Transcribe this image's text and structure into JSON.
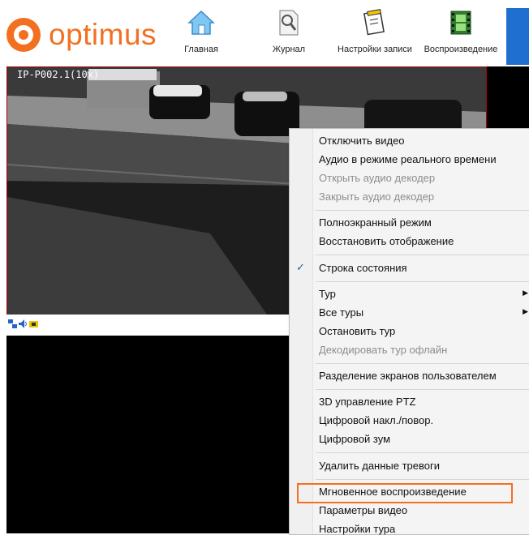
{
  "brand": {
    "logo_text": "optimus",
    "accent": "#f37021"
  },
  "nav": [
    {
      "label": "Главная",
      "icon": "home-icon"
    },
    {
      "label": "Журнал",
      "icon": "journal-icon"
    },
    {
      "label": "Настройки записи",
      "icon": "record-settings-icon"
    },
    {
      "label": "Воспроизведение",
      "icon": "playback-icon"
    }
  ],
  "video": {
    "camera_label": "IP-P002.1(10x)"
  },
  "context_menu": {
    "items": [
      {
        "label": "Отключить видео",
        "enabled": true
      },
      {
        "label": "Аудио в режиме реального времени",
        "enabled": true
      },
      {
        "label": "Открыть аудио декодер",
        "enabled": false
      },
      {
        "label": "Закрыть аудио декодер",
        "enabled": false
      },
      {
        "label": "Полноэкранный режим",
        "enabled": true
      },
      {
        "label": "Восстановить отображение",
        "enabled": true
      },
      {
        "label": "Строка состояния",
        "enabled": true,
        "checked": true
      },
      {
        "label": "Тур",
        "enabled": true,
        "submenu": true
      },
      {
        "label": "Все туры",
        "enabled": true,
        "submenu": true
      },
      {
        "label": "Остановить тур",
        "enabled": true
      },
      {
        "label": "Декодировать тур офлайн",
        "enabled": false
      },
      {
        "label": "Разделение экранов пользователем",
        "enabled": true
      },
      {
        "label": "3D управление PTZ",
        "enabled": true
      },
      {
        "label": "Цифровой накл./повор.",
        "enabled": true
      },
      {
        "label": "Цифровой зум",
        "enabled": true
      },
      {
        "label": "Удалить данные тревоги",
        "enabled": true
      },
      {
        "label": "Мгновенное воспроизведение",
        "enabled": true,
        "highlighted": true
      },
      {
        "label": "Параметры видео",
        "enabled": true
      },
      {
        "label": "Настройки тура",
        "enabled": true
      }
    ]
  }
}
